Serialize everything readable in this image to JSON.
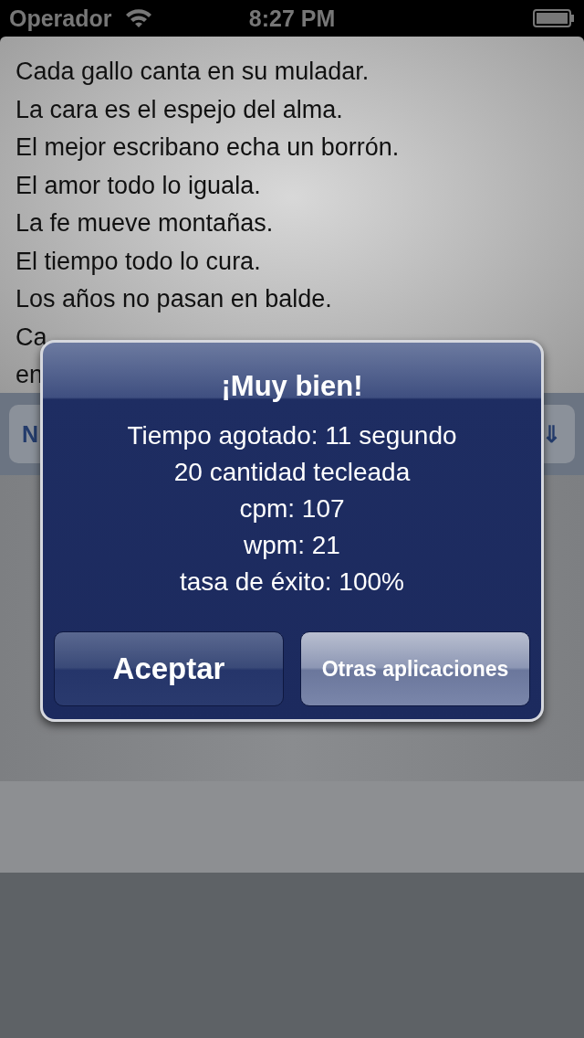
{
  "status_bar": {
    "carrier": "Operador",
    "time": "8:27 PM"
  },
  "proverbs": [
    "Cada gallo canta en su muladar.",
    "La cara es el espejo del alma.",
    "El mejor escribano echa un borrón.",
    "El amor todo lo iguala.",
    "La fe mueve montañas.",
    "El tiempo todo lo cura.",
    "Los años no pasan en balde.",
    "Ca",
    "en"
  ],
  "toolbar": {
    "buttons": [
      {
        "label": "N"
      },
      {
        "label": "⇓"
      }
    ]
  },
  "alert": {
    "title": "¡Muy bien!",
    "lines": [
      "Tiempo agotado: 11 segundo",
      "20 cantidad tecleada",
      "cpm: 107",
      "wpm: 21",
      "tasa de éxito: 100%"
    ],
    "buttons": [
      {
        "label": "Aceptar",
        "primary": true
      },
      {
        "label": "Otras aplicaciones",
        "primary": false
      }
    ]
  }
}
